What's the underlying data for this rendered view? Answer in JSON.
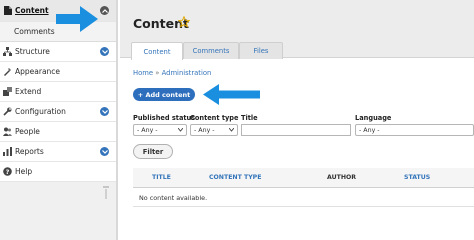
{
  "sidebar": {
    "items": [
      {
        "label": "Content",
        "icon": "content-icon"
      },
      {
        "label": "Comments"
      },
      {
        "label": "Structure",
        "icon": "structure-icon"
      },
      {
        "label": "Appearance",
        "icon": "appearance-icon"
      },
      {
        "label": "Extend",
        "icon": "extend-icon"
      },
      {
        "label": "Configuration",
        "icon": "wrench-icon"
      },
      {
        "label": "People",
        "icon": "people-icon"
      },
      {
        "label": "Reports",
        "icon": "reports-icon"
      },
      {
        "label": "Help",
        "icon": "help-icon"
      }
    ]
  },
  "header": {
    "title": "Content",
    "tabs": [
      {
        "label": "Content",
        "active": true
      },
      {
        "label": "Comments",
        "active": false
      },
      {
        "label": "Files",
        "active": false
      }
    ]
  },
  "breadcrumb": {
    "home": "Home",
    "separator": "»",
    "current": "Administration"
  },
  "actions": {
    "add_content": "+ Add content"
  },
  "filters": {
    "published_status": {
      "label": "Published status",
      "value": "- Any -"
    },
    "content_type": {
      "label": "Content type",
      "value": "- Any -"
    },
    "title": {
      "label": "Title",
      "value": ""
    },
    "language": {
      "label": "Language",
      "value": "- Any -"
    },
    "filter_button": "Filter"
  },
  "table": {
    "columns": [
      "TITLE",
      "CONTENT TYPE",
      "AUTHOR",
      "STATUS"
    ],
    "empty_message": "No content available."
  },
  "colors": {
    "accent": "#3474ba",
    "arrow": "#1a8fe0",
    "button": "#2e6fbd"
  }
}
